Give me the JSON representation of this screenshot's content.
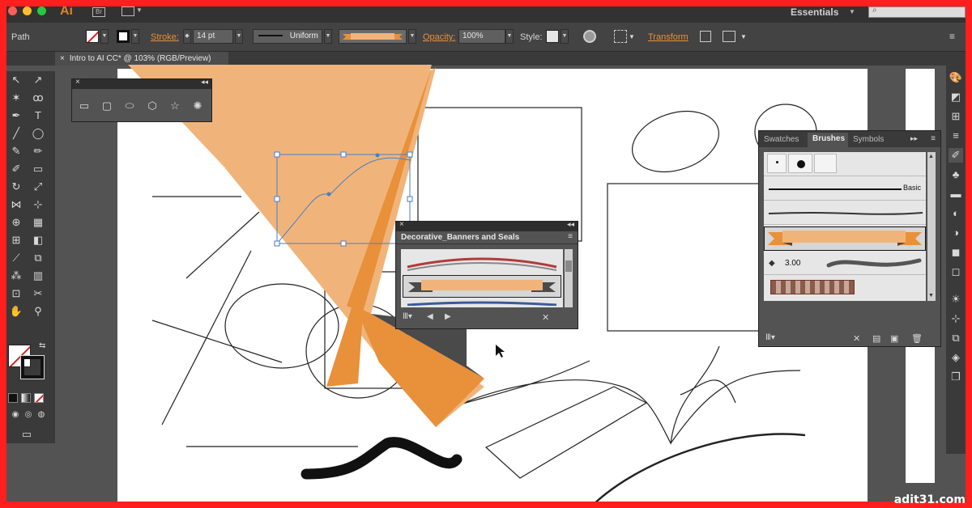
{
  "app": {
    "logo": "Ai",
    "bridge": "Br",
    "workspace": "Essentials"
  },
  "control_bar": {
    "selection_type": "Path",
    "stroke_label": "Stroke:",
    "stroke_value": "14 pt",
    "profile_value": "Uniform",
    "opacity_label": "Opacity:",
    "opacity_value": "100%",
    "style_label": "Style:",
    "transform_label": "Transform"
  },
  "document": {
    "tab_title": "Intro to AI CC* @ 103% (RGB/Preview)"
  },
  "brush_library_panel": {
    "title": "Decorative_Banners and Seals"
  },
  "brushes_panel": {
    "tabs": [
      "Swatches",
      "Brushes",
      "Symbols"
    ],
    "active_tab": "Brushes",
    "rows": [
      {
        "label": "Basic"
      },
      {
        "label": ""
      },
      {
        "label": ""
      },
      {
        "label": "3.00"
      },
      {
        "label": ""
      }
    ]
  },
  "colors": {
    "accent": "#e8903a",
    "banner_fill": "#f0b47a",
    "dark_wedge": "#4a4a4a",
    "selection": "#4a7fc1"
  },
  "watermark": "adit31.com"
}
